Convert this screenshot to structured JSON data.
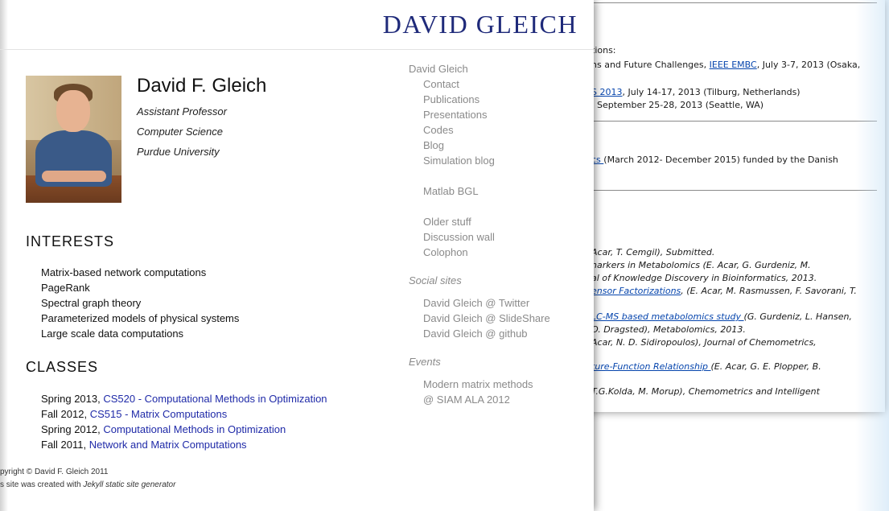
{
  "background_window": {
    "lines": [
      {
        "segments": [
          {
            "text": "tions:"
          }
        ]
      },
      {
        "segments": [
          {
            "text": "ns and Future Challenges, "
          },
          {
            "text": "IEEE EMBC",
            "link": true
          },
          {
            "text": ", July 3-7, 2013 (Osaka,"
          }
        ]
      },
      {
        "segments": [
          {
            "text": "S 2013",
            "link": true
          },
          {
            "text": ", July 14-17, 2013 (Tilburg, Netherlands)"
          }
        ]
      },
      {
        "segments": [
          {
            "text": ", September 25-28, 2013 (Seattle, WA)"
          }
        ]
      },
      {
        "segments": [
          {
            "text": "cs ",
            "link": true
          },
          {
            "text": "(March 2012- December 2015) funded by the Danish"
          }
        ]
      },
      {
        "segments": [
          {
            "text": "Acar, T. Cemgil), Submitted."
          }
        ],
        "italic": true
      },
      {
        "segments": [
          {
            "text": "narkers in Metabolomics (E. Acar, G. Gurdeniz, M."
          }
        ],
        "italic": true
      },
      {
        "segments": [
          {
            "text": "al of Knowledge Discovery in Bioinformatics, 2013."
          }
        ],
        "italic": true
      },
      {
        "segments": [
          {
            "text": "ensor Factorizations",
            "link": true
          },
          {
            "text": ", (E. Acar, M. Rasmussen, F. Savorani, T."
          }
        ],
        "italic": true
      },
      {
        "segments": [
          {
            "text": "LC-MS based metabolomics study ",
            "link": true
          },
          {
            "text": "(G. Gurdeniz, L. Hansen,"
          }
        ],
        "italic": true
      },
      {
        "segments": [
          {
            "text": "O. Dragsted), Metabolomics, 2013."
          }
        ],
        "italic": true
      },
      {
        "segments": [
          {
            "text": "Acar, N. D. Sidiropoulos), Journal of Chemometrics,"
          }
        ],
        "italic": true
      },
      {
        "segments": [
          {
            "text": "ture-Function Relationship ",
            "link": true
          },
          {
            "text": "(E. Acar, G. E. Plopper, B."
          }
        ],
        "italic": true
      },
      {
        "segments": [
          {
            "text": "T.G.Kolda, M. Morup), Chemometrics and Intelligent"
          }
        ],
        "italic": true
      }
    ]
  },
  "site_title": "DAVID GLEICH",
  "profile": {
    "name": "David F. Gleich",
    "title": "Assistant Professor",
    "department": "Computer Science",
    "university": "Purdue University"
  },
  "interests": {
    "heading": "INTERESTS",
    "items": [
      "Matrix-based network computations",
      "PageRank",
      "Spectral graph theory",
      "Parameterized models of physical systems",
      "Large scale data computations"
    ]
  },
  "classes": {
    "heading": "CLASSES",
    "items": [
      {
        "term": "Spring 2013, ",
        "course": "CS520 - Computational Methods in Optimization"
      },
      {
        "term": "Fall 2012, ",
        "course": "CS515 - Matrix Computations"
      },
      {
        "term": "Spring 2012, ",
        "course": "Computational Methods in Optimization"
      },
      {
        "term": "Fall 2011, ",
        "course": "Network and Matrix Computations"
      }
    ]
  },
  "footer": {
    "copyright": "pyright © David F. Gleich 2011",
    "built_prefix": "s site was created with ",
    "built_tool": "Jekyll static site generator"
  },
  "sidebar": {
    "home": "David Gleich",
    "nav": [
      "Contact",
      "Publications",
      "Presentations",
      "Codes",
      "Blog",
      "Simulation blog"
    ],
    "tools": [
      "Matlab BGL"
    ],
    "misc": [
      "Older stuff",
      "Discussion wall",
      "Colophon"
    ],
    "social_heading": "Social sites",
    "social": [
      "David Gleich @ Twitter",
      "David Gleich @ SlideShare",
      "David Gleich @ github"
    ],
    "events_heading": "Events",
    "events": [
      "Modern matrix methods",
      "@ SIAM ALA 2012"
    ]
  },
  "colors": {
    "title": "#1f2a7a",
    "link": "#1f2aa8",
    "sidebar": "#8a8a8a",
    "bg_link": "#0645ad"
  }
}
